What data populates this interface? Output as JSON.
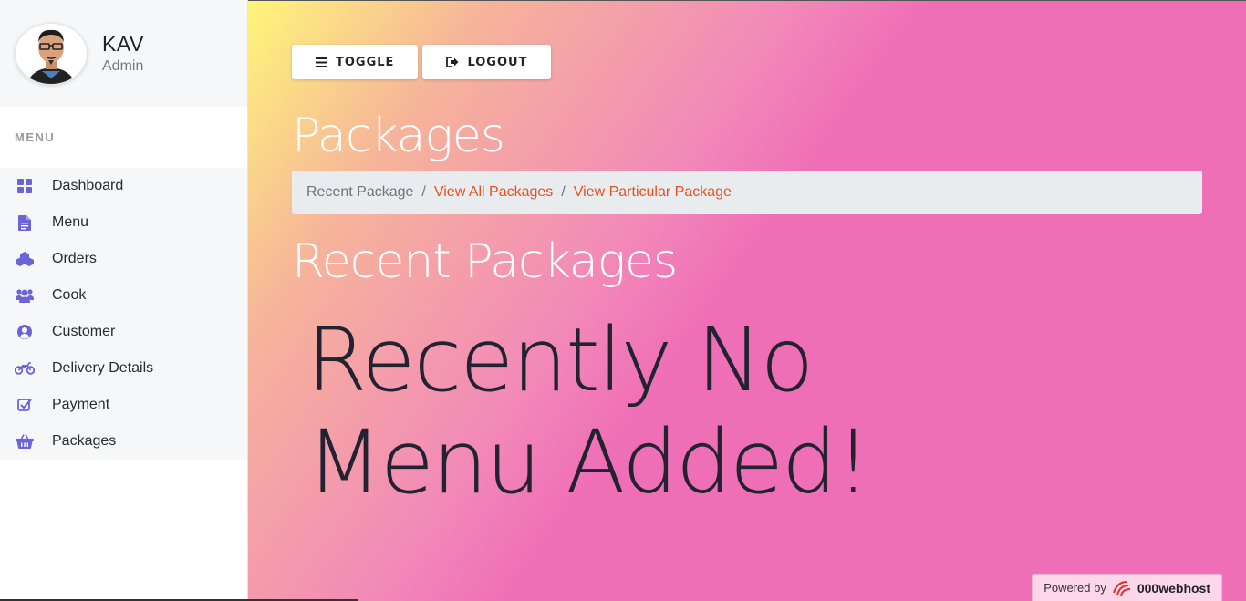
{
  "profile": {
    "name": "KAV",
    "role": "Admin"
  },
  "sidebar": {
    "heading": "MENU",
    "items": [
      {
        "label": "Dashboard",
        "icon": "dashboard-grid-icon"
      },
      {
        "label": "Menu",
        "icon": "document-icon"
      },
      {
        "label": "Orders",
        "icon": "cubes-icon"
      },
      {
        "label": "Cook",
        "icon": "users-icon"
      },
      {
        "label": "Customer",
        "icon": "user-circle-icon"
      },
      {
        "label": "Delivery Details",
        "icon": "motorcycle-icon"
      },
      {
        "label": "Payment",
        "icon": "check-square-icon"
      },
      {
        "label": "Packages",
        "icon": "basket-icon"
      }
    ]
  },
  "toolbar": {
    "toggle_label": "TOGGLE",
    "logout_label": "LOGOUT"
  },
  "page": {
    "title": "Packages",
    "breadcrumb": [
      "Recent Package",
      "View All Packages",
      "View Particular Package"
    ],
    "section_title": "Recent Packages",
    "empty_message": "Recently No Menu Added!"
  },
  "footer": {
    "powered_by": "Powered by",
    "brand": "000webhost"
  },
  "colors": {
    "icon": "#6c63d6",
    "link": "#e8501e",
    "breadcrumb_bg": "#e9ecef"
  }
}
